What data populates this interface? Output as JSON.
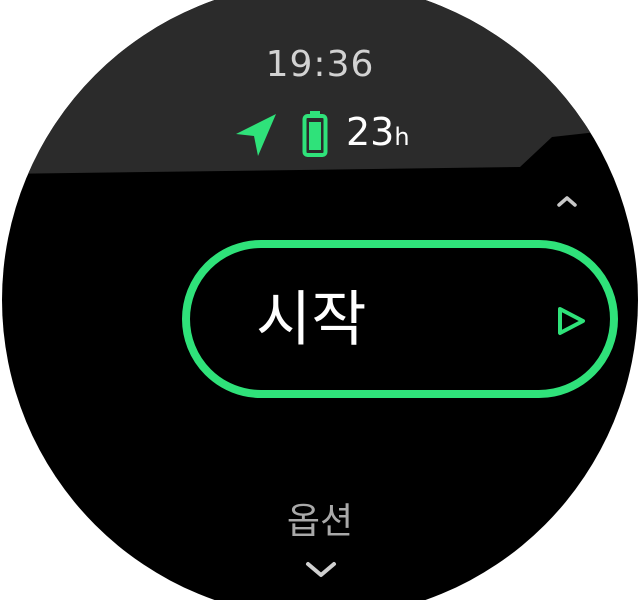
{
  "status": {
    "time": "19:36",
    "battery_hours_value": "23",
    "battery_hours_unit": "h",
    "gps_icon": "gps-arrow-icon",
    "battery_icon": "battery-icon"
  },
  "menu": {
    "start_label": "시작",
    "options_label": "옵션",
    "start_icon": "play-triangle-icon",
    "scroll_up_icon": "chevron-up-icon",
    "scroll_down_icon": "chevron-down-icon"
  },
  "colors": {
    "accent": "#2fe27a",
    "top_band": "#2b2b2b",
    "background": "#000000",
    "text_primary": "#ffffff",
    "text_secondary": "#a9a9a9"
  }
}
